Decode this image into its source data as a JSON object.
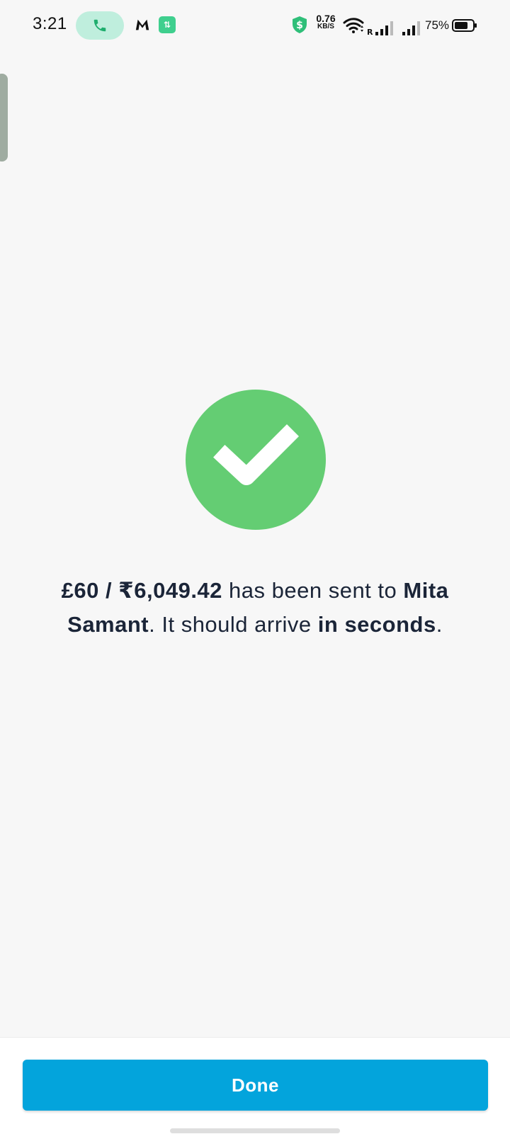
{
  "status_bar": {
    "time": "3:21",
    "app_badge": "⇅",
    "speed_value": "0.76",
    "speed_unit": "KB/S",
    "signal_label": "R",
    "battery_percent": "75%",
    "battery_level": 0.75,
    "call_pill_color": "#bfeedd",
    "call_icon_color": "#1fae6e"
  },
  "success_icon": {
    "name": "checkmark-icon",
    "color": "#64cd73"
  },
  "message": {
    "amount": "£60 / ₹6,049.42",
    "text_1": " has been sent to ",
    "recipient": "Mita Samant",
    "text_2": ". It should arrive ",
    "eta": "in seconds",
    "text_3": "."
  },
  "actions": {
    "done_label": "Done",
    "done_color": "#03a4dc"
  }
}
